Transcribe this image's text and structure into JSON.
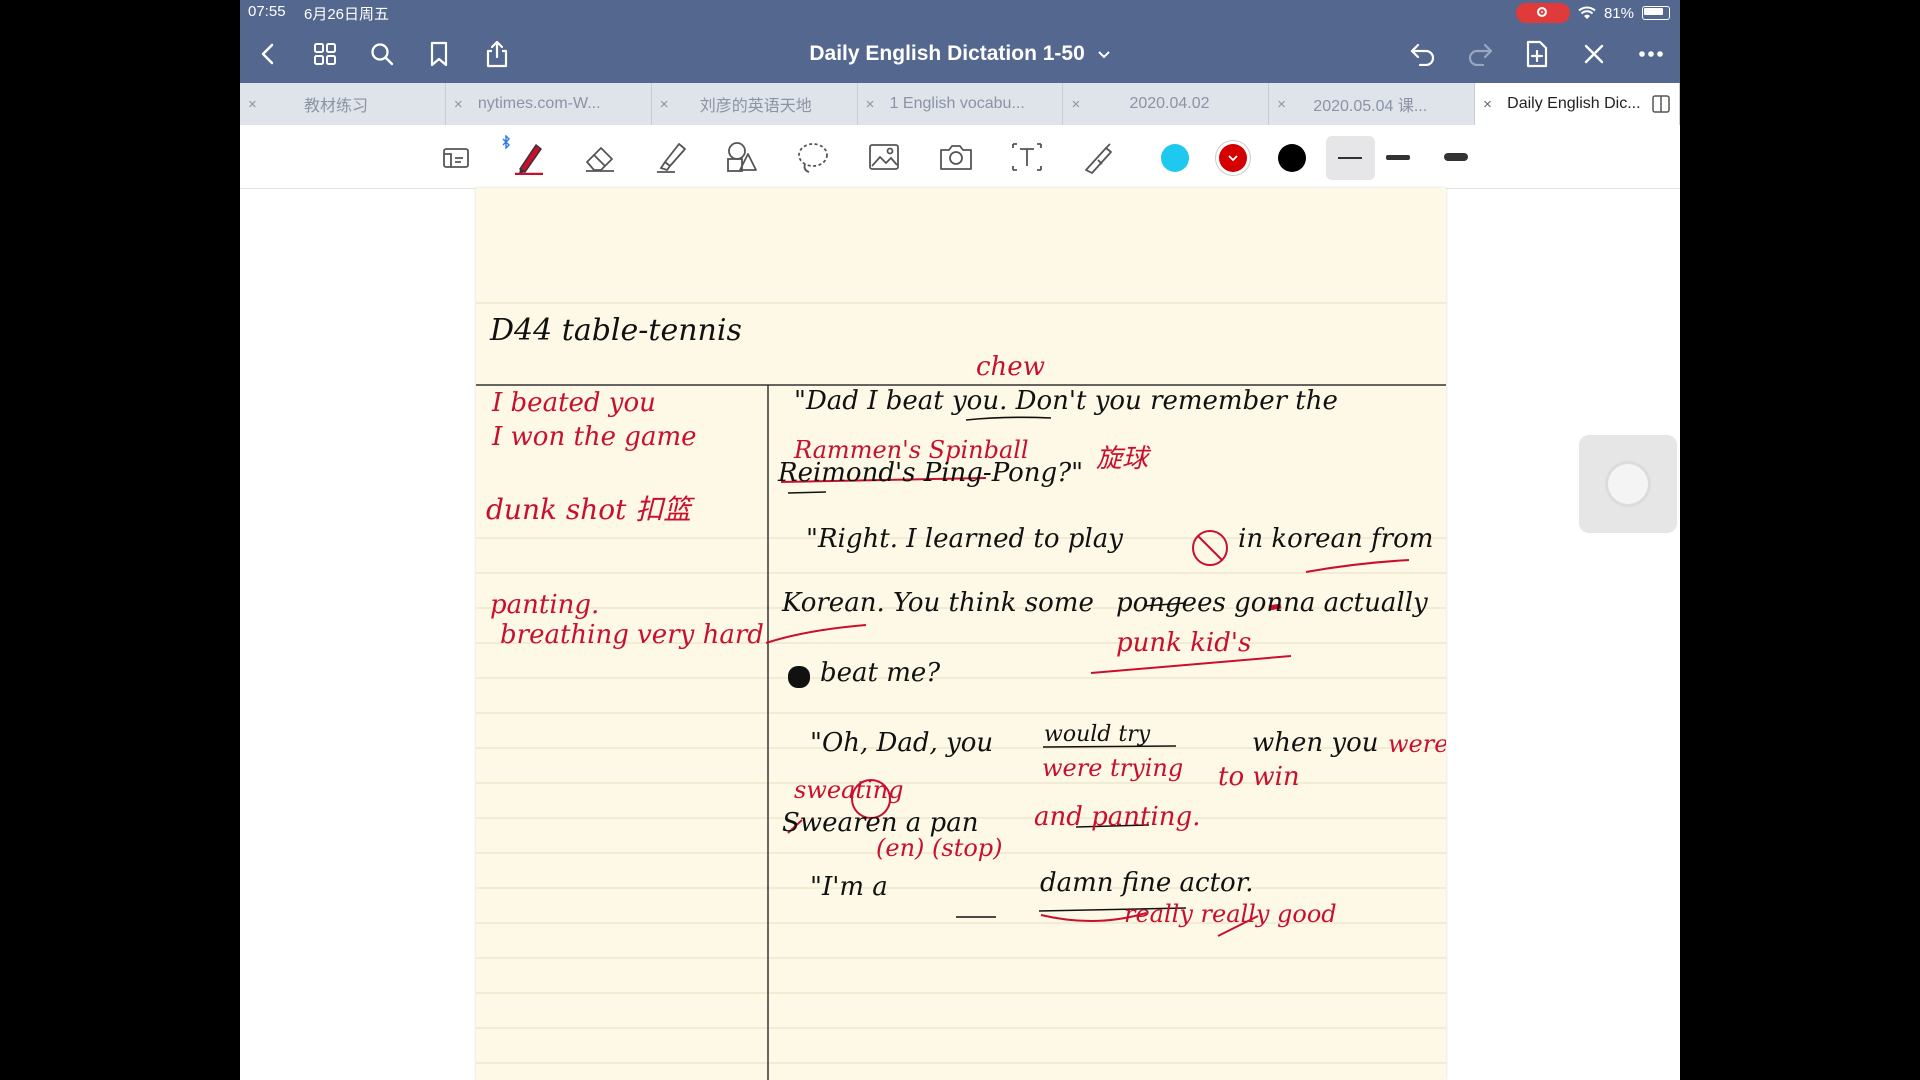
{
  "status_bar": {
    "time": "07:55",
    "date": "6月26日周五",
    "battery": "81%"
  },
  "nav": {
    "title": "Daily English Dictation 1-50",
    "icons": [
      "back-icon",
      "grid-icon",
      "search-icon",
      "bookmark-icon",
      "share-icon",
      "undo-icon",
      "redo-icon",
      "add-page-icon",
      "close-icon",
      "more-icon"
    ]
  },
  "tabs": [
    {
      "label": "教材练习",
      "close": "×"
    },
    {
      "label": "nytimes.com-W...",
      "close": "×"
    },
    {
      "label": "刘彦的英语天地",
      "close": "×"
    },
    {
      "label": "1 English vocabu...",
      "close": "×"
    },
    {
      "label": "2020.04.02",
      "close": "×"
    },
    {
      "label": "2020.05.04 课...",
      "close": "×"
    },
    {
      "label": "Daily English Dic...",
      "close": "×"
    }
  ],
  "toolbar": {
    "tools": [
      "read-mode-icon",
      "pen-icon",
      "eraser-icon",
      "highlighter-icon",
      "shapes-icon",
      "lasso-icon",
      "image-icon",
      "camera-icon",
      "text-icon",
      "laser-icon"
    ],
    "colors": [
      "#1ec8ee",
      "#d40000",
      "#000000"
    ],
    "selected_color": "#d40000"
  },
  "notes": {
    "heading": "D44 table-tennis",
    "left": [
      {
        "text": "I beated you",
        "color": "#c8102e"
      },
      {
        "text": "I won the game",
        "color": "#c8102e"
      },
      {
        "text": "dunk shot 扣篮",
        "color": "#c8102e"
      },
      {
        "text": "panting.",
        "color": "#c8102e"
      },
      {
        "text": "breathing very hard",
        "color": "#c8102e"
      }
    ],
    "right": [
      {
        "text": "chew",
        "color": "#c8102e"
      },
      {
        "text": "\"Dad I beat you. Don't you remember the",
        "color": "#111111"
      },
      {
        "text": "Rammen's Spinball",
        "color": "#c8102e"
      },
      {
        "text": "旋球",
        "color": "#c8102e"
      },
      {
        "text": "Reimond's Ping-Pong?\"",
        "color": "#111111"
      },
      {
        "text": "\"Right. I learned to play",
        "color": "#111111"
      },
      {
        "text": "in korean from",
        "color": "#111111"
      },
      {
        "text": "Korean. You think some",
        "color": "#111111"
      },
      {
        "text": "pongees gonna actually",
        "color": "#111111"
      },
      {
        "text": "punk kid's",
        "color": "#c8102e"
      },
      {
        "text": "beat me?",
        "color": "#111111"
      },
      {
        "text": "\"Oh, Dad, you",
        "color": "#111111"
      },
      {
        "text": "would try",
        "color": "#111111"
      },
      {
        "text": "when you",
        "color": "#111111"
      },
      {
        "text": "were",
        "color": "#c8102e"
      },
      {
        "text": "were trying",
        "color": "#c8102e"
      },
      {
        "text": "to win",
        "color": "#c8102e"
      },
      {
        "text": "sweating",
        "color": "#c8102e"
      },
      {
        "text": "Swearen a pan",
        "color": "#111111"
      },
      {
        "text": "and panting.",
        "color": "#c8102e"
      },
      {
        "text": "(en) (stop)",
        "color": "#c8102e"
      },
      {
        "text": "\"I'm a",
        "color": "#111111"
      },
      {
        "text": "damn fine actor.",
        "color": "#111111"
      },
      {
        "text": "really really good",
        "color": "#c8102e"
      }
    ]
  }
}
